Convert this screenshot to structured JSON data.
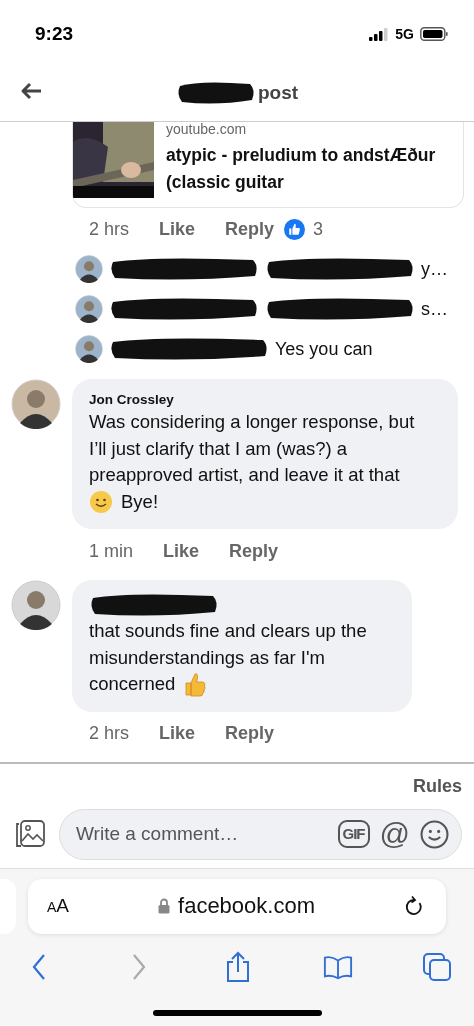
{
  "status_bar": {
    "time": "9:23",
    "network": "5G"
  },
  "header": {
    "title": "post"
  },
  "link_card": {
    "kind": "picture",
    "domain": "youtube.com",
    "title": "atypic - preludium to andstÆður (classic guitar"
  },
  "post_actions": {
    "time": "2 hrs",
    "like": "Like",
    "reply": "Reply",
    "reactions": "3"
  },
  "reply_previews": [
    {
      "kind": "truncated",
      "snippet": "y…"
    },
    {
      "kind": "truncated",
      "snippet": "s…"
    },
    {
      "kind": "full",
      "snippet": "Yes you can"
    }
  ],
  "comments": [
    {
      "redacted": false,
      "author": "Jon Crossley",
      "kind": "smile",
      "text": "Was considering a longer response, but I’ll just clarify that I am (was?) a preapproved artist, and leave it at that",
      "after": "Bye!",
      "time": "1 min",
      "like": "Like",
      "reply": "Reply"
    },
    {
      "redacted": true,
      "kind": "thumbs",
      "text": "that sounds fine and clears up the misunderstandings as far I'm",
      "after": "concerned",
      "time": "2 hrs",
      "like": "Like",
      "reply": "Reply"
    }
  ],
  "rules": "Rules",
  "composer": {
    "placeholder": "Write a comment…",
    "gif": "GIF",
    "mention": "@"
  },
  "browser": {
    "font_button": "AA",
    "url": "facebook.com"
  }
}
